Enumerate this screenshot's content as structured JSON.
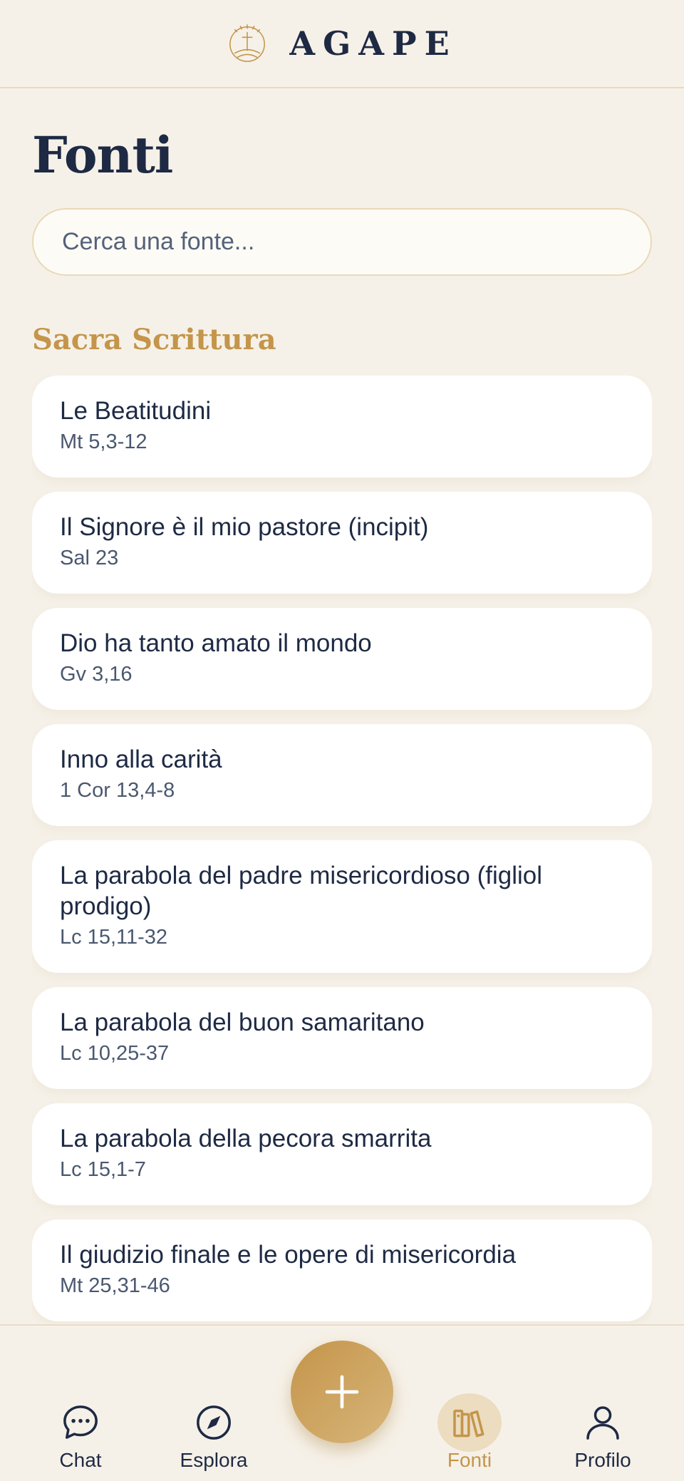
{
  "header": {
    "brand": "AGAPE"
  },
  "page": {
    "title": "Fonti"
  },
  "search": {
    "placeholder": "Cerca una fonte..."
  },
  "section": {
    "title": "Sacra Scrittura",
    "items": [
      {
        "title": "Le Beatitudini",
        "ref": "Mt 5,3-12"
      },
      {
        "title": "Il Signore è il mio pastore (incipit)",
        "ref": "Sal 23"
      },
      {
        "title": "Dio ha tanto amato il mondo",
        "ref": "Gv 3,16"
      },
      {
        "title": "Inno alla carità",
        "ref": "1 Cor 13,4-8"
      },
      {
        "title": "La parabola del padre misericordioso (figliol prodigo)",
        "ref": "Lc 15,11-32"
      },
      {
        "title": "La parabola del buon samaritano",
        "ref": "Lc 10,25-37"
      },
      {
        "title": "La parabola della pecora smarrita",
        "ref": "Lc 15,1-7"
      },
      {
        "title": "Il giudizio finale e le opere di misericordia",
        "ref": "Mt 25,31-46"
      }
    ]
  },
  "nav": {
    "chat": "Chat",
    "explore": "Esplora",
    "sources": "Fonti",
    "profile": "Profilo",
    "active": "sources"
  },
  "colors": {
    "background": "#f6f1e8",
    "accent": "#c4954a",
    "navy": "#1e2a44",
    "card": "#ffffff"
  },
  "icons": {
    "logo": "cross-sun-logo-icon",
    "chat": "chat-bubble-icon",
    "explore": "compass-icon",
    "sources": "books-icon",
    "profile": "user-icon",
    "add": "plus-icon"
  }
}
